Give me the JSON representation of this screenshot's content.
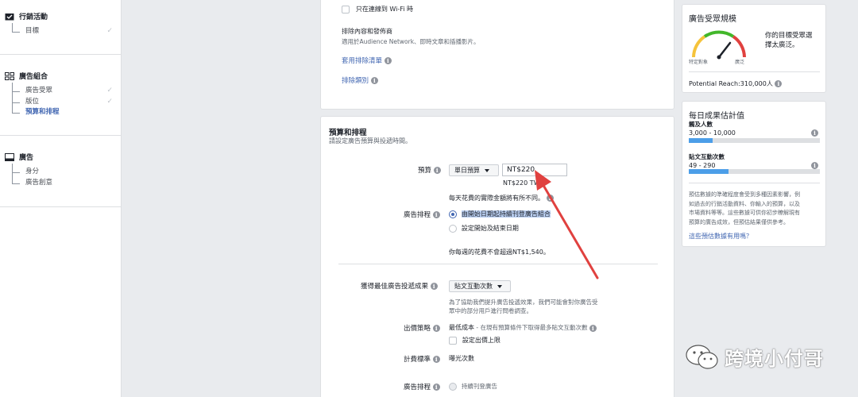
{
  "sidebar": {
    "campaign": {
      "title": "行銷活動",
      "items": [
        {
          "label": "目標",
          "checked": true
        }
      ]
    },
    "adset": {
      "title": "廣告組合",
      "items": [
        {
          "label": "廣告受眾",
          "checked": true
        },
        {
          "label": "版位",
          "checked": true
        },
        {
          "label": "預算和排程",
          "checked": false,
          "active": true
        }
      ]
    },
    "ad": {
      "title": "廣告",
      "items": [
        {
          "label": "身分"
        },
        {
          "label": "廣告創意"
        }
      ]
    }
  },
  "placements": {
    "wifi_only": "只在連線到 Wi-Fi 時",
    "exclude_title": "排除內容和發佈商",
    "exclude_desc": "適用於Audience Network、即時文章和插播影片。",
    "apply_blocklist": "套用排除清單",
    "exclude_categories": "排除類別"
  },
  "budget": {
    "section_title": "預算和排程",
    "section_desc": "請設定廣告預算與投遞時間。",
    "budget_label": "預算",
    "budget_type": "單日預算",
    "budget_value": "NT$220",
    "budget_twd": "NT$220 TWD",
    "daily_note": "每天花費的實際金額將有所不同。",
    "schedule_label": "廣告排程",
    "schedule_opt1": "由開始日期起持續刊登廣告組合",
    "schedule_opt2": "設定開始及結束日期",
    "weekly_note": "你每週的花費不會超過NT$1,540。",
    "optimize_label": "獲得最佳廣告投遞成果",
    "optimize_value": "貼文互動次數",
    "optimize_desc_line1": "為了協助我們提升廣告投遞效果，我們可能會對你廣告受",
    "optimize_desc_line2": "眾中的部分用戶進行問卷調查。",
    "bid_label": "出價策略",
    "bid_value": "最低成本",
    "bid_desc": " - 在現有預算條件下取得最多貼文互動次數",
    "bid_cap": "設定出價上限",
    "billing_label": "計費標準",
    "billing_value": "曝光次數",
    "schedule2_label": "廣告排程",
    "schedule2_value": "持續刊登廣告"
  },
  "audience_size": {
    "title": "廣告受眾規模",
    "desc_line1": "你的目標受眾選",
    "desc_line2": "擇太廣泛。",
    "gauge_left": "特定對象",
    "gauge_right": "廣泛",
    "potential_reach": "Potential Reach:310,000人"
  },
  "estimates": {
    "title": "每日成果估計值",
    "reach_label": "觸及人數",
    "reach_range": "3,000 - 10,000",
    "reach_fill": 0.18,
    "engage_label": "貼文互動次數",
    "engage_range": "49 - 290",
    "engage_fill": 0.3,
    "note_lines": [
      "預估數據的準確程度會受到多種因素影響，例",
      "如過去的行銷活動資料、你輸入的預算，以及",
      "市場資料等等。這些數據可供你初步瞭解現有",
      "預算的廣告成效，但預估結果僅供參考。"
    ],
    "helpful_link": "這些預估數據有用嗎？"
  },
  "watermark": {
    "text": "跨境小付哥"
  },
  "colors": {
    "accent": "#4267b2",
    "arrow": "#e0413f",
    "bar": "#4c9ee8"
  }
}
